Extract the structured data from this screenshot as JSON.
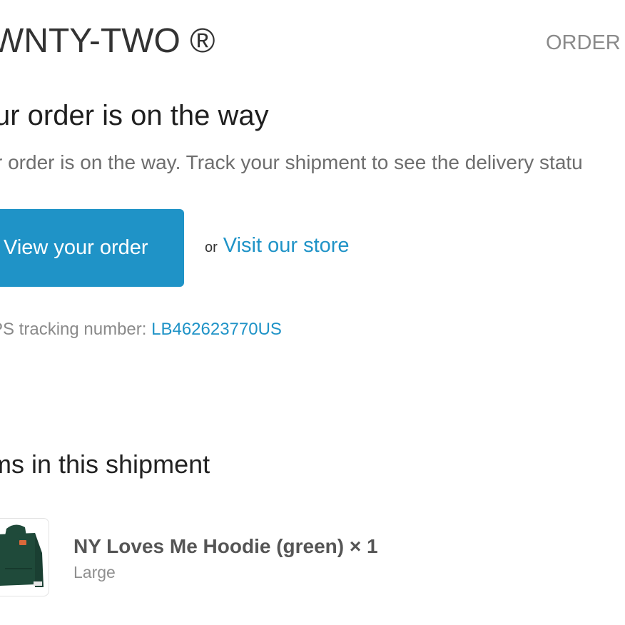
{
  "header": {
    "brand": "WNTY-TWO ®",
    "order_label": "ORDER #"
  },
  "main": {
    "heading": "ur order is on the way",
    "subtext": "r order is on the way. Track your shipment to see the delivery statu",
    "view_order_button": "View your order",
    "or_text": "or",
    "visit_store_link": "Visit our store",
    "tracking_label": "PS tracking number: ",
    "tracking_number": "LB462623770US"
  },
  "shipment": {
    "heading": "ms in this shipment",
    "items": [
      {
        "name": "NY Loves Me Hoodie (green) × 1",
        "variant": "Large",
        "thumbnail_icon": "green-hoodie-image"
      }
    ]
  },
  "colors": {
    "accent": "#1f93c7",
    "hoodie_green": "#1f4a3a",
    "hoodie_print": "#d9683a"
  }
}
